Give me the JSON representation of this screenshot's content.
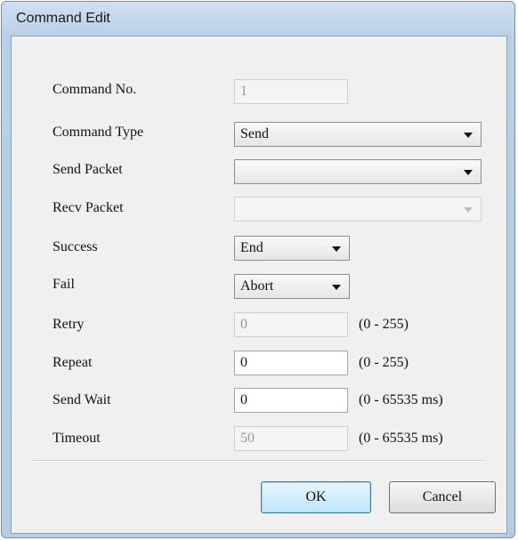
{
  "window": {
    "title": "Command Edit"
  },
  "form": {
    "command_no": {
      "label": "Command No.",
      "value": "1"
    },
    "command_type": {
      "label": "Command Type",
      "value": "Send"
    },
    "send_packet": {
      "label": "Send Packet",
      "value": ""
    },
    "recv_packet": {
      "label": "Recv Packet",
      "value": ""
    },
    "success": {
      "label": "Success",
      "value": "End"
    },
    "fail": {
      "label": "Fail",
      "value": "Abort"
    },
    "retry": {
      "label": "Retry",
      "value": "0",
      "range": "(0 - 255)"
    },
    "repeat": {
      "label": "Repeat",
      "value": "0",
      "range": "(0 - 255)"
    },
    "send_wait": {
      "label": "Send Wait",
      "value": "0",
      "range": "(0 - 65535 ms)"
    },
    "timeout": {
      "label": "Timeout",
      "value": "50",
      "range": "(0 - 65535 ms)"
    }
  },
  "buttons": {
    "ok": "OK",
    "cancel": "Cancel"
  },
  "icons": {
    "dropdown": "chevron-down-icon"
  },
  "colors": {
    "titlebar": "#b9cfe6",
    "client": "#f0f0f0",
    "default_button": "#bee6fd"
  }
}
